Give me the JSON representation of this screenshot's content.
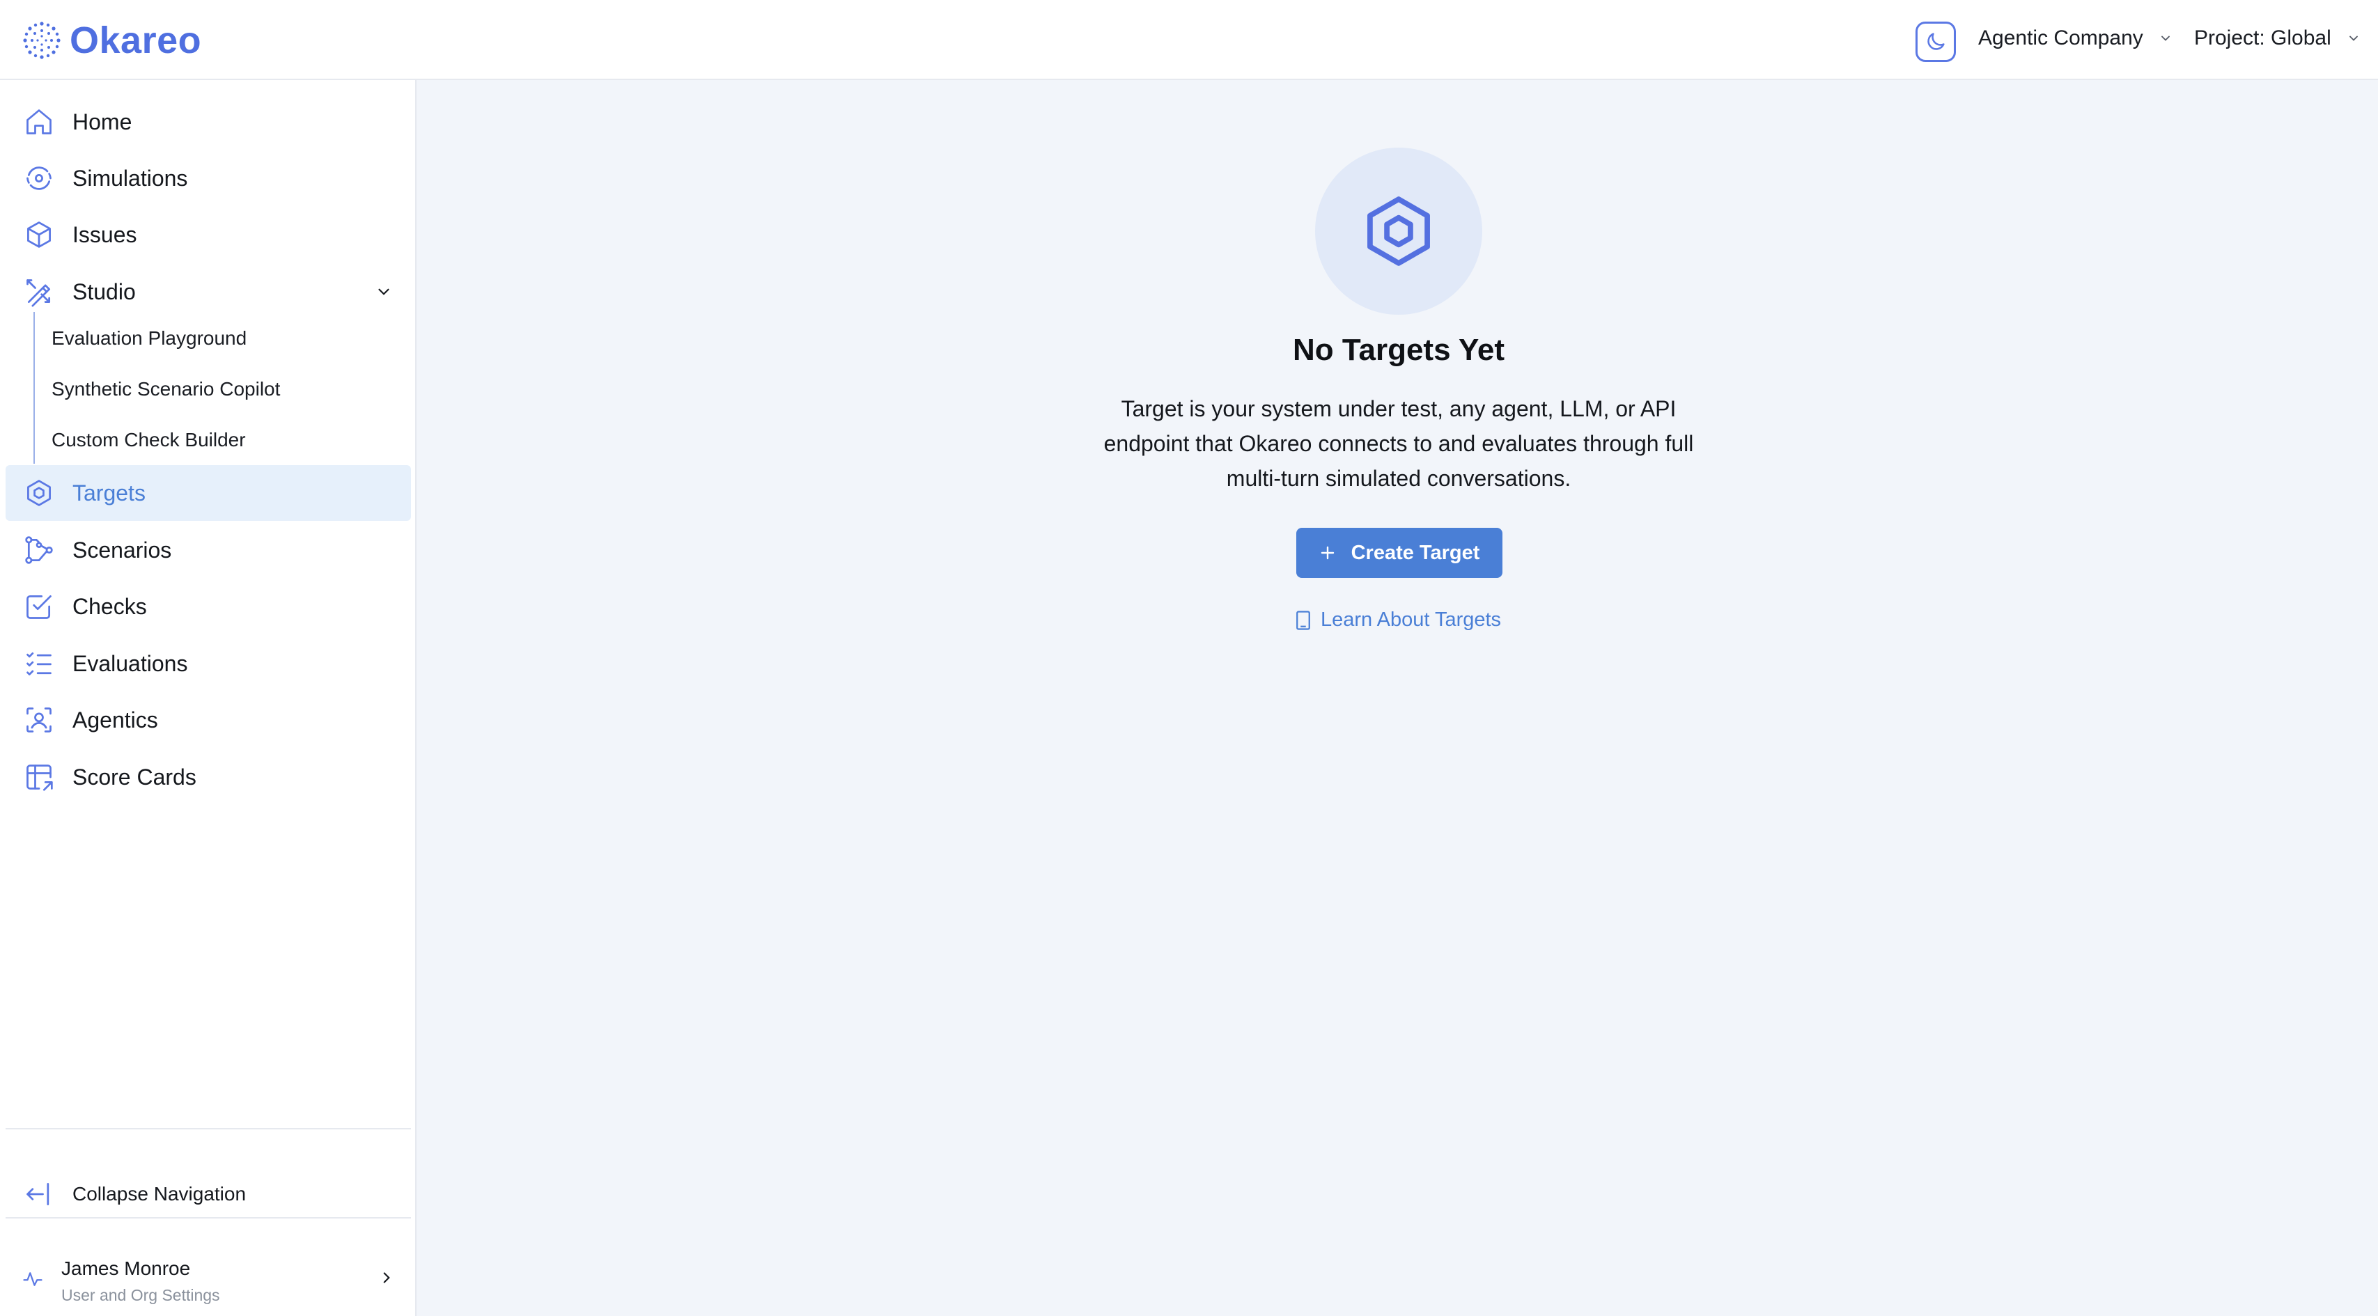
{
  "app": {
    "brand_name": "Okareo",
    "accent": "#4f6fe0",
    "link_color": "#4a7fd6"
  },
  "header": {
    "theme_icon": "moon-icon",
    "company": "Agentic Company",
    "project": "Project: Global"
  },
  "sidebar": {
    "items": [
      {
        "label": "Home",
        "icon": "home-icon"
      },
      {
        "label": "Simulations",
        "icon": "simulations-icon"
      },
      {
        "label": "Issues",
        "icon": "cube-icon"
      },
      {
        "label": "Studio",
        "icon": "tools-icon",
        "expanded": true
      },
      {
        "label": "Targets",
        "icon": "hexagon-icon",
        "active": true
      },
      {
        "label": "Scenarios",
        "icon": "flow-icon"
      },
      {
        "label": "Checks",
        "icon": "checkbox-icon"
      },
      {
        "label": "Evaluations",
        "icon": "list-check-icon"
      },
      {
        "label": "Agentics",
        "icon": "face-scan-icon"
      },
      {
        "label": "Score Cards",
        "icon": "table-arrow-icon"
      }
    ],
    "studio_subitems": [
      {
        "label": "Evaluation Playground"
      },
      {
        "label": "Synthetic Scenario Copilot"
      },
      {
        "label": "Custom Check Builder"
      }
    ],
    "collapse_label": "Collapse Navigation",
    "user": {
      "name": "James Monroe",
      "subtitle": "User and Org Settings"
    }
  },
  "main": {
    "empty_state": {
      "icon": "hexagon-icon",
      "title": "No Targets Yet",
      "description": "Target is your system under test, any agent, LLM, or API endpoint that Okareo connects to and evaluates through full multi-turn simulated conversations.",
      "primary_button": "Create Target",
      "link": "Learn About Targets"
    }
  }
}
